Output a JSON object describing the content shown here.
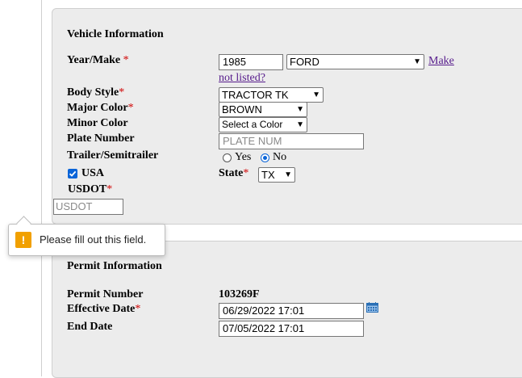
{
  "vehicle": {
    "title": "Vehicle Information",
    "year_make_label": "Year/Make",
    "year_value": "1985",
    "make_value": "FORD",
    "make_link_line1": "Make",
    "make_link_line2": "not listed?",
    "body_style_label": "Body Style",
    "body_style_value": "TRACTOR TK",
    "major_color_label": "Major Color",
    "major_color_value": "BROWN",
    "minor_color_label": "Minor Color",
    "minor_color_value": "Select a Color",
    "plate_label": "Plate Number",
    "plate_placeholder": "PLATE NUM",
    "trailer_label": "Trailer/Semitrailer",
    "trailer_yes": "Yes",
    "trailer_no": "No",
    "trailer_selected": "No",
    "usa_label": "USA",
    "usa_checked": true,
    "state_label": "State",
    "state_value": "TX",
    "usdot_label": "USDOT",
    "usdot_placeholder": "USDOT",
    "required_mark": "*"
  },
  "validation": {
    "message": "Please fill out this field.",
    "icon": "warning-icon"
  },
  "permit": {
    "title": "Permit Information",
    "number_label": "Permit Number",
    "number_value": "103269F",
    "effective_label": "Effective Date",
    "effective_value": "06/29/2022 17:01",
    "end_label": "End Date",
    "end_value": "07/05/2022 17:01",
    "calendar_icon": "calendar-icon"
  },
  "colors": {
    "required": "#d00000",
    "link": "#551a8b",
    "accent": "#0a64d8",
    "warning": "#f1a000",
    "panel_bg": "#ececec"
  }
}
